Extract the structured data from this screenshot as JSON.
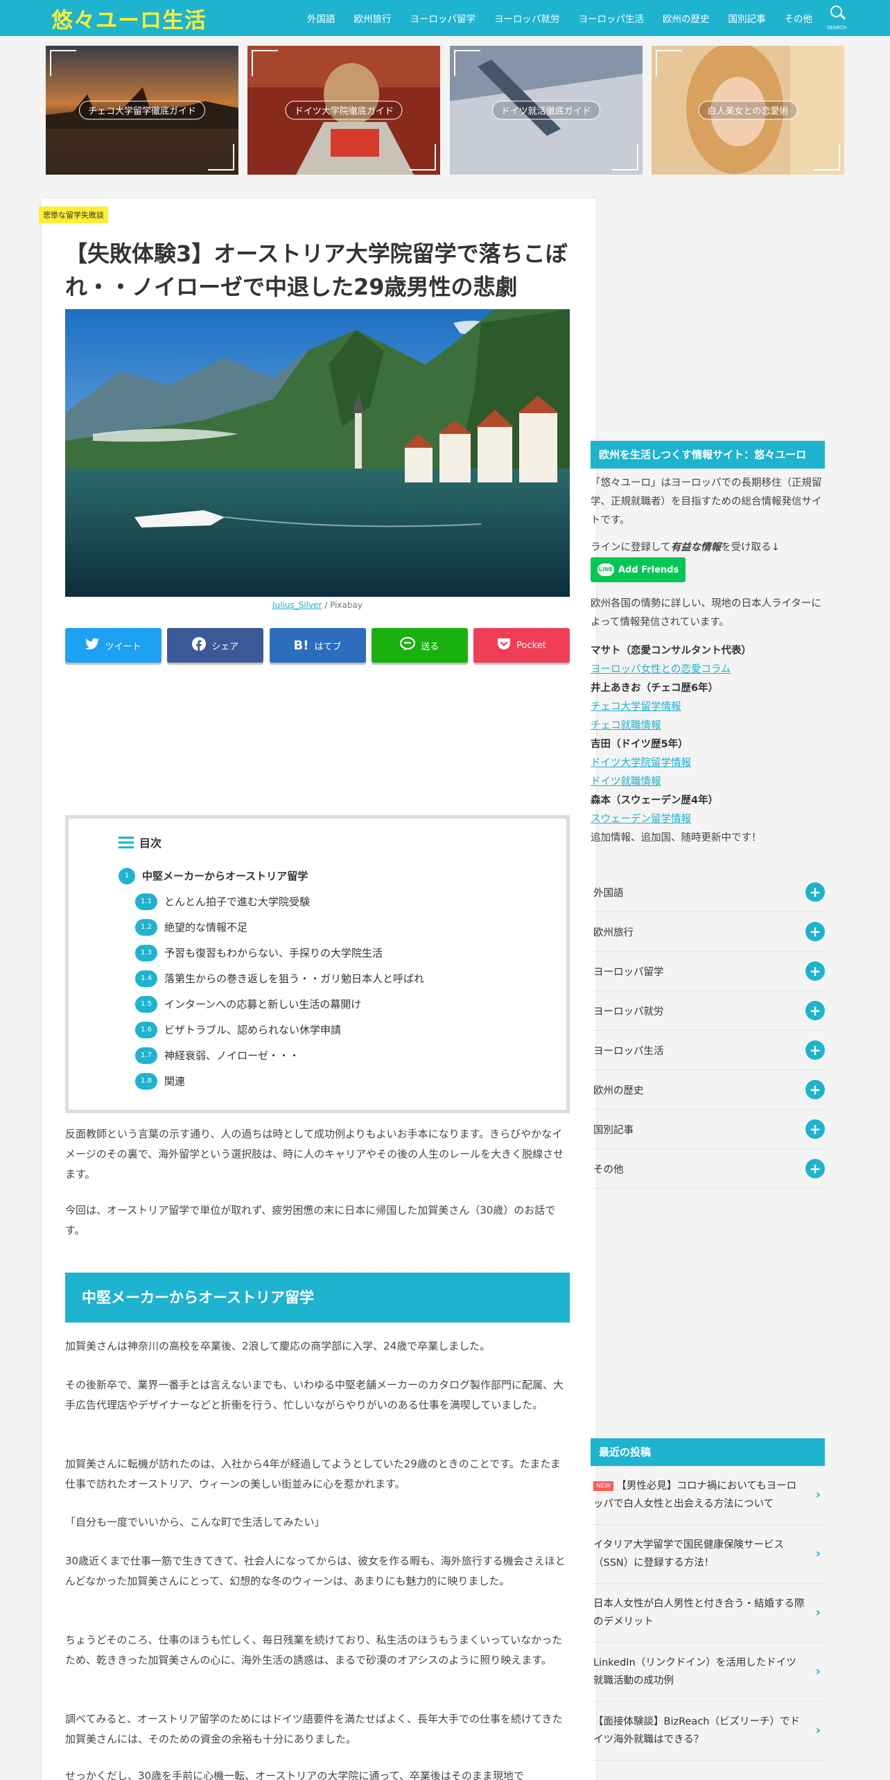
{
  "header": {
    "logo": "悠々ユーロ生活",
    "nav": [
      "外国語",
      "欧州旅行",
      "ヨーロッパ留学",
      "ヨーロッパ就労",
      "ヨーロッパ生活",
      "欧州の歴史",
      "国別記事",
      "その他"
    ],
    "search_label": "SEARCH",
    "accent": "#1eb3cf",
    "logo_color": "#ffee33"
  },
  "featured": [
    {
      "label": "チェコ大学留学徹底ガイド"
    },
    {
      "label": "ドイツ大学院徹底ガイド"
    },
    {
      "label": "ドイツ就活徹底ガイド"
    },
    {
      "label": "白人美女との恋愛術"
    }
  ],
  "article": {
    "category": "悲惨な留学失敗談",
    "title": "【失敗体験3】オーストリア大学院留学で落ちこぼれ・・ノイローゼで中退した29歳男性の悲劇",
    "credit_author": "Julius_Silver",
    "credit_source": " / Pixabay",
    "share": [
      {
        "label": "ツイート",
        "icon": "twitter-icon",
        "color": "#1da1f2"
      },
      {
        "label": "シェア",
        "icon": "facebook-icon",
        "color": "#3b5998"
      },
      {
        "label": "はてブ",
        "icon": "hatena-icon",
        "color": "#2c6ebd"
      },
      {
        "label": "送る",
        "icon": "line-icon",
        "color": "#1ab10f"
      },
      {
        "label": "Pocket",
        "icon": "pocket-icon",
        "color": "#ef3e56"
      }
    ],
    "toc": {
      "title": "目次",
      "items": [
        {
          "num": "1",
          "label": "中堅メーカーからオーストリア留学",
          "level": 1
        },
        {
          "num": "1.1",
          "label": "とんとん拍子で進む大学院受験",
          "level": 2
        },
        {
          "num": "1.2",
          "label": "絶望的な情報不足",
          "level": 2
        },
        {
          "num": "1.3",
          "label": "予習も復習もわからない、手探りの大学院生活",
          "level": 2
        },
        {
          "num": "1.4",
          "label": "落第生からの巻き返しを狙う・・ガリ勉日本人と呼ばれ",
          "level": 2
        },
        {
          "num": "1.5",
          "label": "インターンへの応募と新しい生活の幕開け",
          "level": 2
        },
        {
          "num": "1.6",
          "label": "ビザトラブル、認められない休学申請",
          "level": 2
        },
        {
          "num": "1.7",
          "label": "神経衰弱、ノイローゼ・・・",
          "level": 2
        },
        {
          "num": "1.8",
          "label": "関連",
          "level": 2
        }
      ]
    },
    "intro": [
      "反面教師という言葉の示す通り、人の過ちは時として成功例よりもよいお手本になります。きらびやかなイメージのその裏で、海外留学という選択肢は、時に人のキャリアやその後の人生のレールを大きく脱線させます。",
      "今回は、オーストリア留学で単位が取れず、疲労困憊の末に日本に帰国した加賀美さん（30歳）のお話です。"
    ],
    "section_heading": "中堅メーカーからオーストリア留学",
    "paragraphs": [
      "加賀美さんは神奈川の高校を卒業後、2浪して慶応の商学部に入学、24歳で卒業しました。",
      "その後新卒で、業界一番手とは言えないまでも、いわゆる中堅老舗メーカーのカタログ製作部門に配属、大手広告代理店やデザイナーなどと折衝を行う、忙しいながらやりがいのある仕事を満喫していました。",
      "加賀美さんに転機が訪れたのは、入社から4年が経過してようとしていた29歳のときのことです。たまたま仕事で訪れたオーストリア、ウィーンの美しい街並みに心を惹かれます。",
      "「自分も一度でいいから、こんな町で生活してみたい」",
      "30歳近くまで仕事一筋で生きてきて、社会人になってからは、彼女を作る暇も、海外旅行する機会さえほとんどなかった加賀美さんにとって、幻想的な冬のウィーンは、あまりにも魅力的に映りました。",
      "ちょうどそのころ、仕事のほうも忙しく、毎日残業を続けており、私生活のほうもうまくいっていなかったため、乾ききった加賀美さんの心に、海外生活の誘惑は、まるで砂漠のオアシスのように照り映えます。",
      "調べてみると、オーストリア留学のためにはドイツ語要件を満たせばよく、長年大手での仕事を続けてきた加賀美さんには、そのための資金の余裕も十分にありました。",
      "せっかくだし、30歳を手前に心機一転、オーストリアの大学院に通って、卒業後はそのまま現地で"
    ]
  },
  "sidebar": {
    "about": {
      "heading": "欧州を生活しつくす情報サイト：悠々ユーロ",
      "desc": "「悠々ユーロ」はヨーロッパでの長期移住（正規留学、正規就職者）を目指すための総合情報発信サイトです。",
      "line_prefix": "ラインに登録して",
      "line_emph": "有益な情報",
      "line_suffix": "を受け取る↓",
      "line_button": "Add Friends",
      "line_icon_text": "LINE",
      "writers_intro": "欧州各国の情勢に詳しい、現地の日本人ライターによって情報発信されています。",
      "writers": [
        {
          "name": "マサト（恋愛コンサルタント代表）",
          "links": [
            "ヨーロッパ女性との恋愛コラム"
          ]
        },
        {
          "name": "井上あきお（チェコ歴6年）",
          "links": [
            "チェコ大学留学情報",
            "チェコ就職情報"
          ]
        },
        {
          "name": "吉田（ドイツ歴5年）",
          "links": [
            "ドイツ大学院留学情報",
            "ドイツ就職情報"
          ]
        },
        {
          "name": "森本（スウェーデン歴4年）",
          "links": [
            "スウェーデン留学情報"
          ]
        }
      ],
      "footer": "追加情報、追加国、随時更新中です！"
    },
    "categories": [
      "外国語",
      "欧州旅行",
      "ヨーロッパ留学",
      "ヨーロッパ就労",
      "ヨーロッパ生活",
      "欧州の歴史",
      "国別記事",
      "その他"
    ],
    "recent_heading": "最近の投稿",
    "recent": [
      {
        "new": "NEW",
        "title": "【男性必見】コロナ禍においてもヨーロッパで白人女性と出会える方法について"
      },
      {
        "new": "",
        "title": "イタリア大学留学で国民健康保険サービス（SSN）に登録する方法！"
      },
      {
        "new": "",
        "title": "日本人女性が白人男性と付き合う・結婚する際のデメリット"
      },
      {
        "new": "",
        "title": "LinkedIn（リンクドイン）を活用したドイツ就職活動の成功例"
      },
      {
        "new": "",
        "title": "【面接体験談】BizReach（ビズリーチ）でドイツ海外就職はできる？"
      }
    ]
  }
}
